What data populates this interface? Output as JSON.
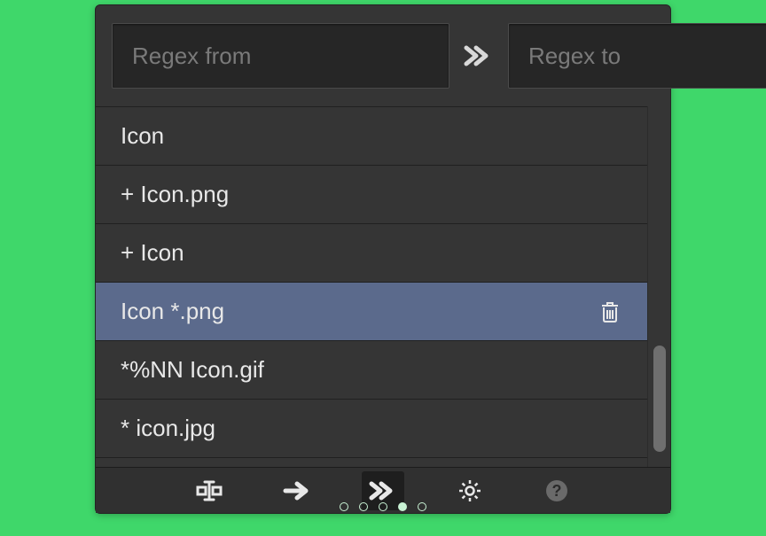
{
  "inputs": {
    "from_placeholder": "Regex from",
    "to_placeholder": "Regex to",
    "from_value": "",
    "to_value": ""
  },
  "list": {
    "selected_index": 3,
    "items": [
      {
        "label": "Icon"
      },
      {
        "label": "+ Icon.png"
      },
      {
        "label": "+ Icon"
      },
      {
        "label": "Icon *.png"
      },
      {
        "label": "*%NN Icon.gif"
      },
      {
        "label": "* icon.jpg"
      }
    ]
  },
  "toolbar": {
    "active_index": 2,
    "buttons": [
      {
        "name": "text-cursor-icon"
      },
      {
        "name": "arrow-right-icon"
      },
      {
        "name": "double-arrow-right-icon"
      },
      {
        "name": "gear-icon"
      },
      {
        "name": "help-icon"
      }
    ]
  },
  "pager": {
    "count": 5,
    "active": 3
  }
}
